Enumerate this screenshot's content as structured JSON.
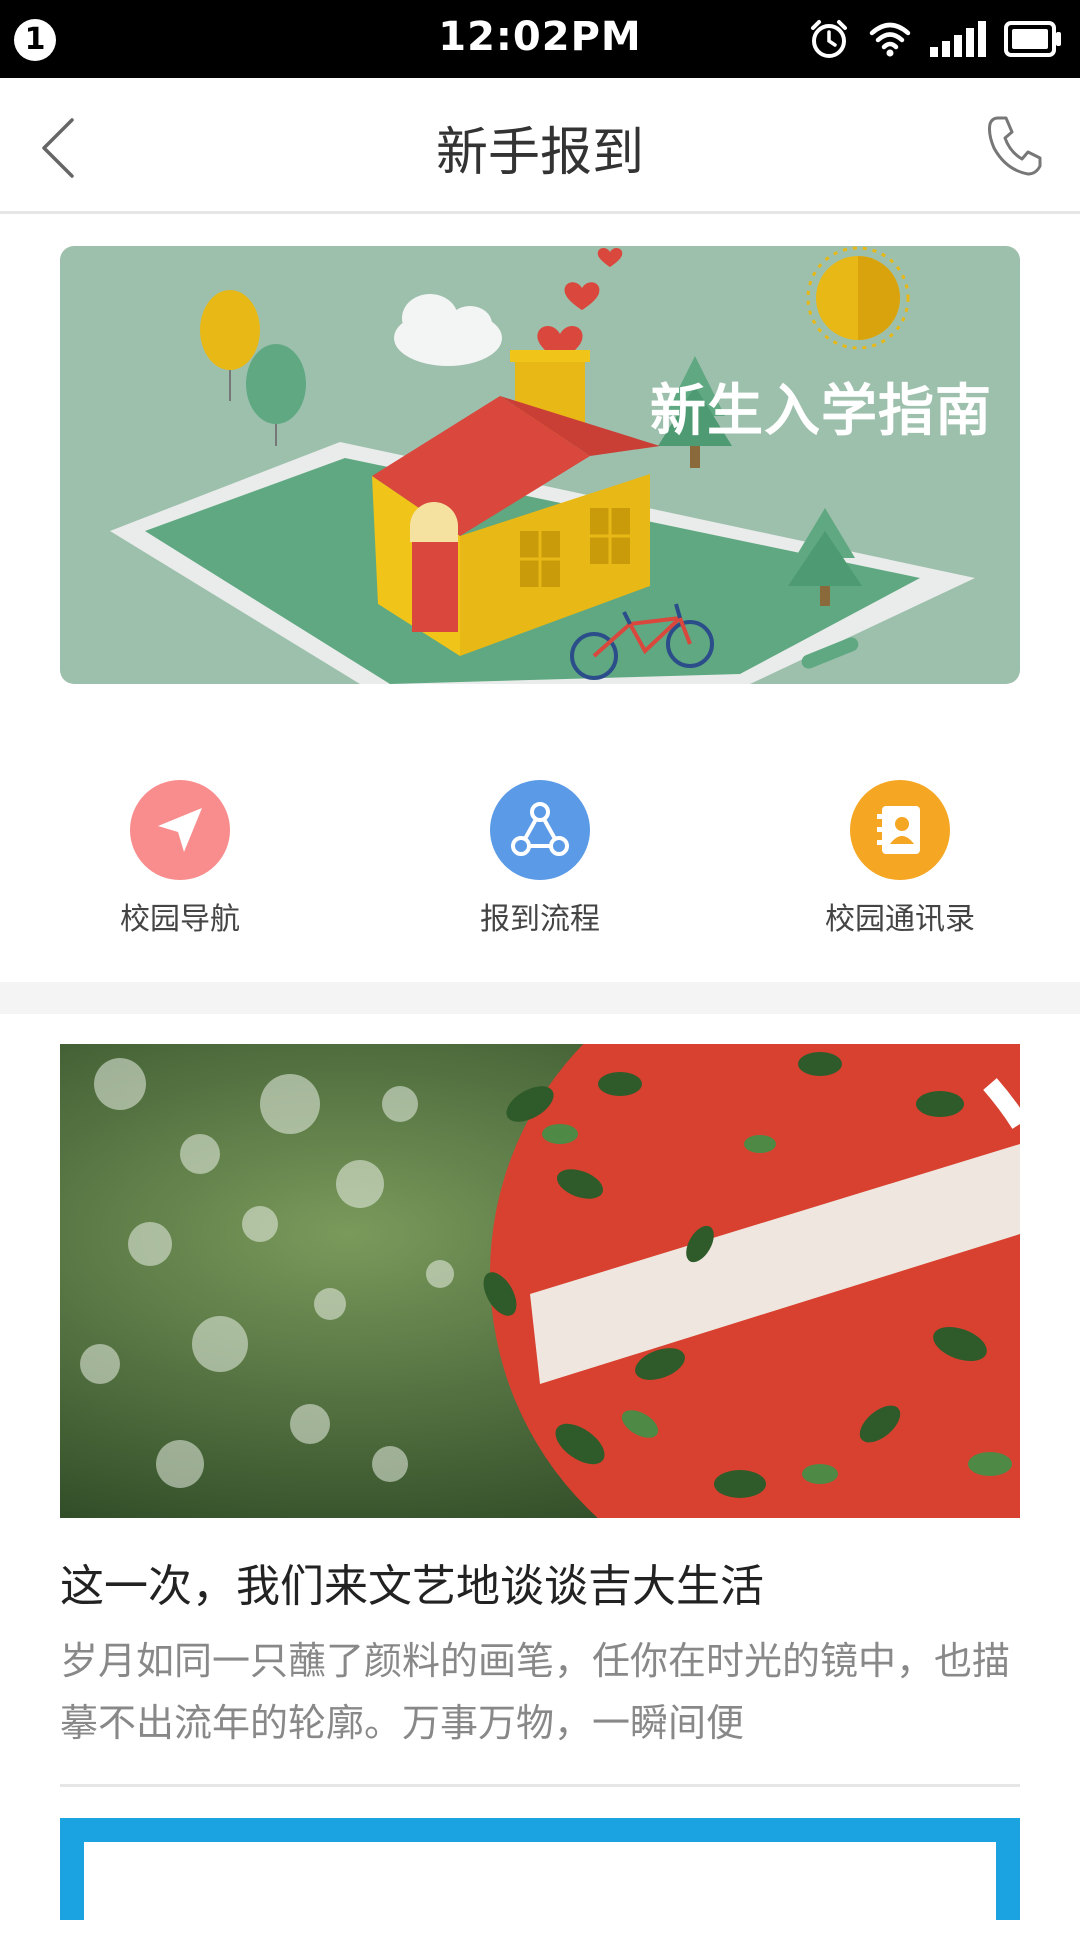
{
  "status_bar": {
    "notification_count": "1",
    "time": "12:02PM",
    "icons": [
      "alarm-icon",
      "wifi-icon",
      "signal-icon",
      "battery-icon"
    ]
  },
  "nav": {
    "title": "新手报到",
    "back_icon": "chevron-left-icon",
    "phone_icon": "phone-icon"
  },
  "hero": {
    "caption": "新生入学指南"
  },
  "quick_actions": [
    {
      "label": "校园导航",
      "icon": "navigation-arrow-icon",
      "color": "#f98d8d"
    },
    {
      "label": "报到流程",
      "icon": "flow-nodes-icon",
      "color": "#5a9ae6"
    },
    {
      "label": "校园通讯录",
      "icon": "contacts-book-icon",
      "color": "#f5a623"
    }
  ],
  "article": {
    "title": "这一次，我们来文艺地谈谈吉大生活",
    "excerpt": "岁月如同一只蘸了颜料的画笔，任你在时光的镜中，也描摹不出流年的轮廓。万事万物，一瞬间便"
  },
  "colors": {
    "status_bar_bg": "#000000",
    "hero_bg": "#9dc0ad",
    "next_card_border": "#1aa3e0"
  }
}
